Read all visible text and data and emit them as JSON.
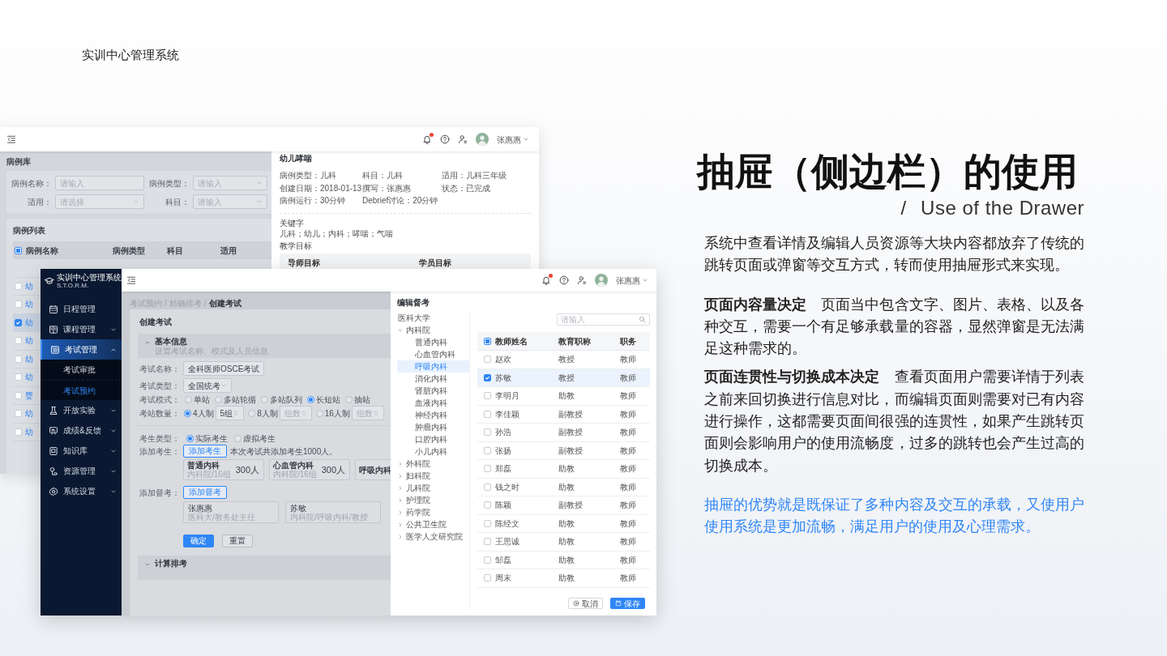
{
  "page_title": "实训中心管理系统",
  "back_window": {
    "header": {
      "user": "张惠惠"
    },
    "page_title": "病例库",
    "filters": [
      {
        "label": "病例名称：",
        "placeholder": "请输入",
        "kind": "input"
      },
      {
        "label": "病例类型：",
        "placeholder": "请输入",
        "kind": "select"
      },
      {
        "label": "适用：",
        "placeholder": "请选择",
        "kind": "select"
      },
      {
        "label": "科目：",
        "placeholder": "请输入",
        "kind": "select"
      }
    ],
    "list_title": "病例列表",
    "table": {
      "header_indeterminate": true,
      "columns": [
        "病例名称",
        "病例类型",
        "科目",
        "适用"
      ],
      "rows": [
        {
          "name": "幼",
          "selected": false
        },
        {
          "name": "幼",
          "selected": false
        },
        {
          "name": "幼",
          "selected": true
        },
        {
          "name": "幼",
          "selected": false
        },
        {
          "name": "幼",
          "selected": false
        },
        {
          "name": "幼",
          "selected": false
        },
        {
          "name": "婴",
          "selected": false
        },
        {
          "name": "幼",
          "selected": false
        },
        {
          "name": "幼",
          "selected": false
        }
      ]
    },
    "drawer": {
      "title": "幼儿哮喘",
      "fields": [
        "病例类型：儿科",
        "科目：儿科",
        "适用：儿科三年级",
        "创建日期：2018-01-13",
        "撰写：张惠惠",
        "状态：已完成",
        "病例运行：30分钟",
        "Debrief讨论：20分钟"
      ],
      "keywords_label": "关键字",
      "keywords": "儿科；幼儿；内科；哮喘；气喘",
      "goals_label": "教学目标",
      "goal_columns": [
        "导师目标",
        "学员目标"
      ]
    }
  },
  "front_window": {
    "sidebar": {
      "brand": "实训中心管理系统",
      "brand_sub": "S.T.O.R.M.",
      "items": [
        {
          "label": "日程管理",
          "kind": "link",
          "selected": false
        },
        {
          "label": "课程管理",
          "kind": "group",
          "selected": false,
          "expanded": false
        },
        {
          "label": "考试管理",
          "kind": "group",
          "selected": true,
          "expanded": true,
          "children": [
            {
              "label": "考试审批",
              "selected": false
            },
            {
              "label": "考试预约",
              "selected": true
            }
          ]
        },
        {
          "label": "开放实验",
          "kind": "group",
          "selected": false,
          "expanded": false
        },
        {
          "label": "成绩&反馈",
          "kind": "group",
          "selected": false,
          "expanded": false
        },
        {
          "label": "知识库",
          "kind": "group",
          "selected": false,
          "expanded": false
        },
        {
          "label": "资源管理",
          "kind": "group",
          "selected": false,
          "expanded": false
        },
        {
          "label": "系统设置",
          "kind": "group",
          "selected": false,
          "expanded": false
        }
      ]
    },
    "header": {
      "user": "张惠惠"
    },
    "breadcrumb": [
      {
        "kind": "link",
        "text": "考试预约"
      },
      {
        "kind": "separator",
        "text": "/"
      },
      {
        "kind": "link",
        "text": "精确排考"
      },
      {
        "kind": "separator",
        "text": "/"
      },
      {
        "kind": "current",
        "text": "创建考试"
      }
    ],
    "card_title": "创建考试",
    "section": {
      "title": "基本信息",
      "subtitle": "设置考试名称、模式及人员信息",
      "expanded": true
    },
    "exam_name": {
      "label": "考试名称：",
      "value": "全科医师OSCE考试"
    },
    "exam_type": {
      "label": "考试类型：",
      "value": "全国统考"
    },
    "exam_mode": {
      "label": "考试模式：",
      "options": [
        {
          "label": "单站",
          "selected": false
        },
        {
          "label": "多站轮循",
          "selected": false
        },
        {
          "label": "多站队列",
          "selected": false
        },
        {
          "label": "长短站",
          "selected": true
        },
        {
          "label": "抽站",
          "selected": false
        }
      ]
    },
    "station_count": {
      "label": "考站数量：",
      "options": [
        {
          "label": "4人制",
          "selected": true,
          "value": "5组"
        },
        {
          "label": "8人制",
          "selected": false,
          "placeholder": "组数"
        },
        {
          "label": "16人制",
          "selected": false,
          "placeholder": "组数"
        }
      ]
    },
    "examinee_type": {
      "label": "考生类型：",
      "options": [
        {
          "label": "实际考生",
          "selected": true
        },
        {
          "label": "虚拟考生",
          "selected": false
        }
      ]
    },
    "add_examinee": {
      "label": "添加考生：",
      "button": "添加考生",
      "note": "本次考试共添加考生1000人。",
      "groups": [
        {
          "name": "普通内科",
          "sub": "内科院/16组",
          "count": "300人"
        },
        {
          "name": "心血管内科",
          "sub": "内科院/16组",
          "count": "300人"
        },
        {
          "name": "呼吸内科"
        }
      ]
    },
    "add_supervisor": {
      "label": "添加督考：",
      "button": "添加督考",
      "people": [
        {
          "name": "张惠惠",
          "sub": "医科大/教务处主任"
        },
        {
          "name": "苏敏",
          "sub": "内科院/呼吸内科/教授"
        }
      ]
    },
    "actions": [
      "确定",
      "重置"
    ],
    "section2": {
      "title": "计算排考",
      "expanded": false
    },
    "drawer": {
      "title": "编辑督考",
      "org": "医科大学",
      "tree": [
        {
          "label": "内科院",
          "expanded": true,
          "children": [
            {
              "label": "普通内科",
              "selected": false
            },
            {
              "label": "心血管内科",
              "selected": false
            },
            {
              "label": "呼吸内科",
              "selected": true
            },
            {
              "label": "消化内科",
              "selected": false
            },
            {
              "label": "肾脏内科",
              "selected": false
            },
            {
              "label": "血液内科",
              "selected": false
            },
            {
              "label": "神经内科",
              "selected": false
            },
            {
              "label": "肿瘤内科",
              "selected": false
            },
            {
              "label": "口腔内科",
              "selected": false
            },
            {
              "label": "小儿内科",
              "selected": false
            }
          ]
        },
        {
          "label": "外科院",
          "expanded": false
        },
        {
          "label": "妇科院",
          "expanded": false
        },
        {
          "label": "儿科院",
          "expanded": false
        },
        {
          "label": "护理院",
          "expanded": false
        },
        {
          "label": "药学院",
          "expanded": false
        },
        {
          "label": "公共卫生院",
          "expanded": false
        },
        {
          "label": "医学人文研究院",
          "expanded": false
        }
      ],
      "search_placeholder": "请输入",
      "header_indeterminate": true,
      "columns": [
        "教师姓名",
        "教育职称",
        "职务"
      ],
      "rows": [
        {
          "name": "赵欢",
          "title": "教授",
          "duty": "教师",
          "selected": false
        },
        {
          "name": "苏敏",
          "title": "教授",
          "duty": "教师",
          "selected": true
        },
        {
          "name": "李明月",
          "title": "助教",
          "duty": "教师",
          "selected": false
        },
        {
          "name": "李佳颖",
          "title": "副教授",
          "duty": "教师",
          "selected": false
        },
        {
          "name": "孙浩",
          "title": "副教授",
          "duty": "教师",
          "selected": false
        },
        {
          "name": "张扬",
          "title": "副教授",
          "duty": "教师",
          "selected": false
        },
        {
          "name": "郑磊",
          "title": "助教",
          "duty": "教师",
          "selected": false
        },
        {
          "name": "钱之时",
          "title": "助教",
          "duty": "教师",
          "selected": false
        },
        {
          "name": "陈颖",
          "title": "副教授",
          "duty": "教师",
          "selected": false
        },
        {
          "name": "陈经文",
          "title": "助教",
          "duty": "教师",
          "selected": false
        },
        {
          "name": "王思诚",
          "title": "助教",
          "duty": "教师",
          "selected": false
        },
        {
          "name": "邹磊",
          "title": "助教",
          "duty": "教师",
          "selected": false
        },
        {
          "name": "周末",
          "title": "助教",
          "duty": "教师",
          "selected": false
        }
      ],
      "buttons": [
        "取消",
        "保存"
      ]
    }
  },
  "article": {
    "title": "抽屉（侧边栏）的使用",
    "subtitle_slash": "/",
    "subtitle": "Use of the Drawer",
    "paragraphs": [
      {
        "kind": "plain",
        "text": "系统中查看详情及编辑人员资源等大块内容都放弃了传统的跳转页面或弹窗等交互方式，转而使用抽屉形式来实现。"
      },
      {
        "kind": "plain",
        "text": "**页面内容量决定**　页面当中包含文字、图片、表格、以及各种交互，需要一个有足够承载量的容器，显然弹窗是无法满足这种需求的。"
      },
      {
        "kind": "plain",
        "text": "**页面连贯性与切换成本决定**　查看页面用户需要详情于列表之前来回切换进行信息对比，而编辑页面则需要对已有内容进行操作，这都需要页面间很强的连贯性，如果产生跳转页面则会影响用户的使用流畅度，过多的跳转也会产生过高的切换成本。"
      },
      {
        "kind": "highlight",
        "text": "抽屉的优势就是既保证了多种内容及交互的承载，又使用户使用系统是更加流畅，满足用户的使用及心理需求。"
      }
    ]
  }
}
